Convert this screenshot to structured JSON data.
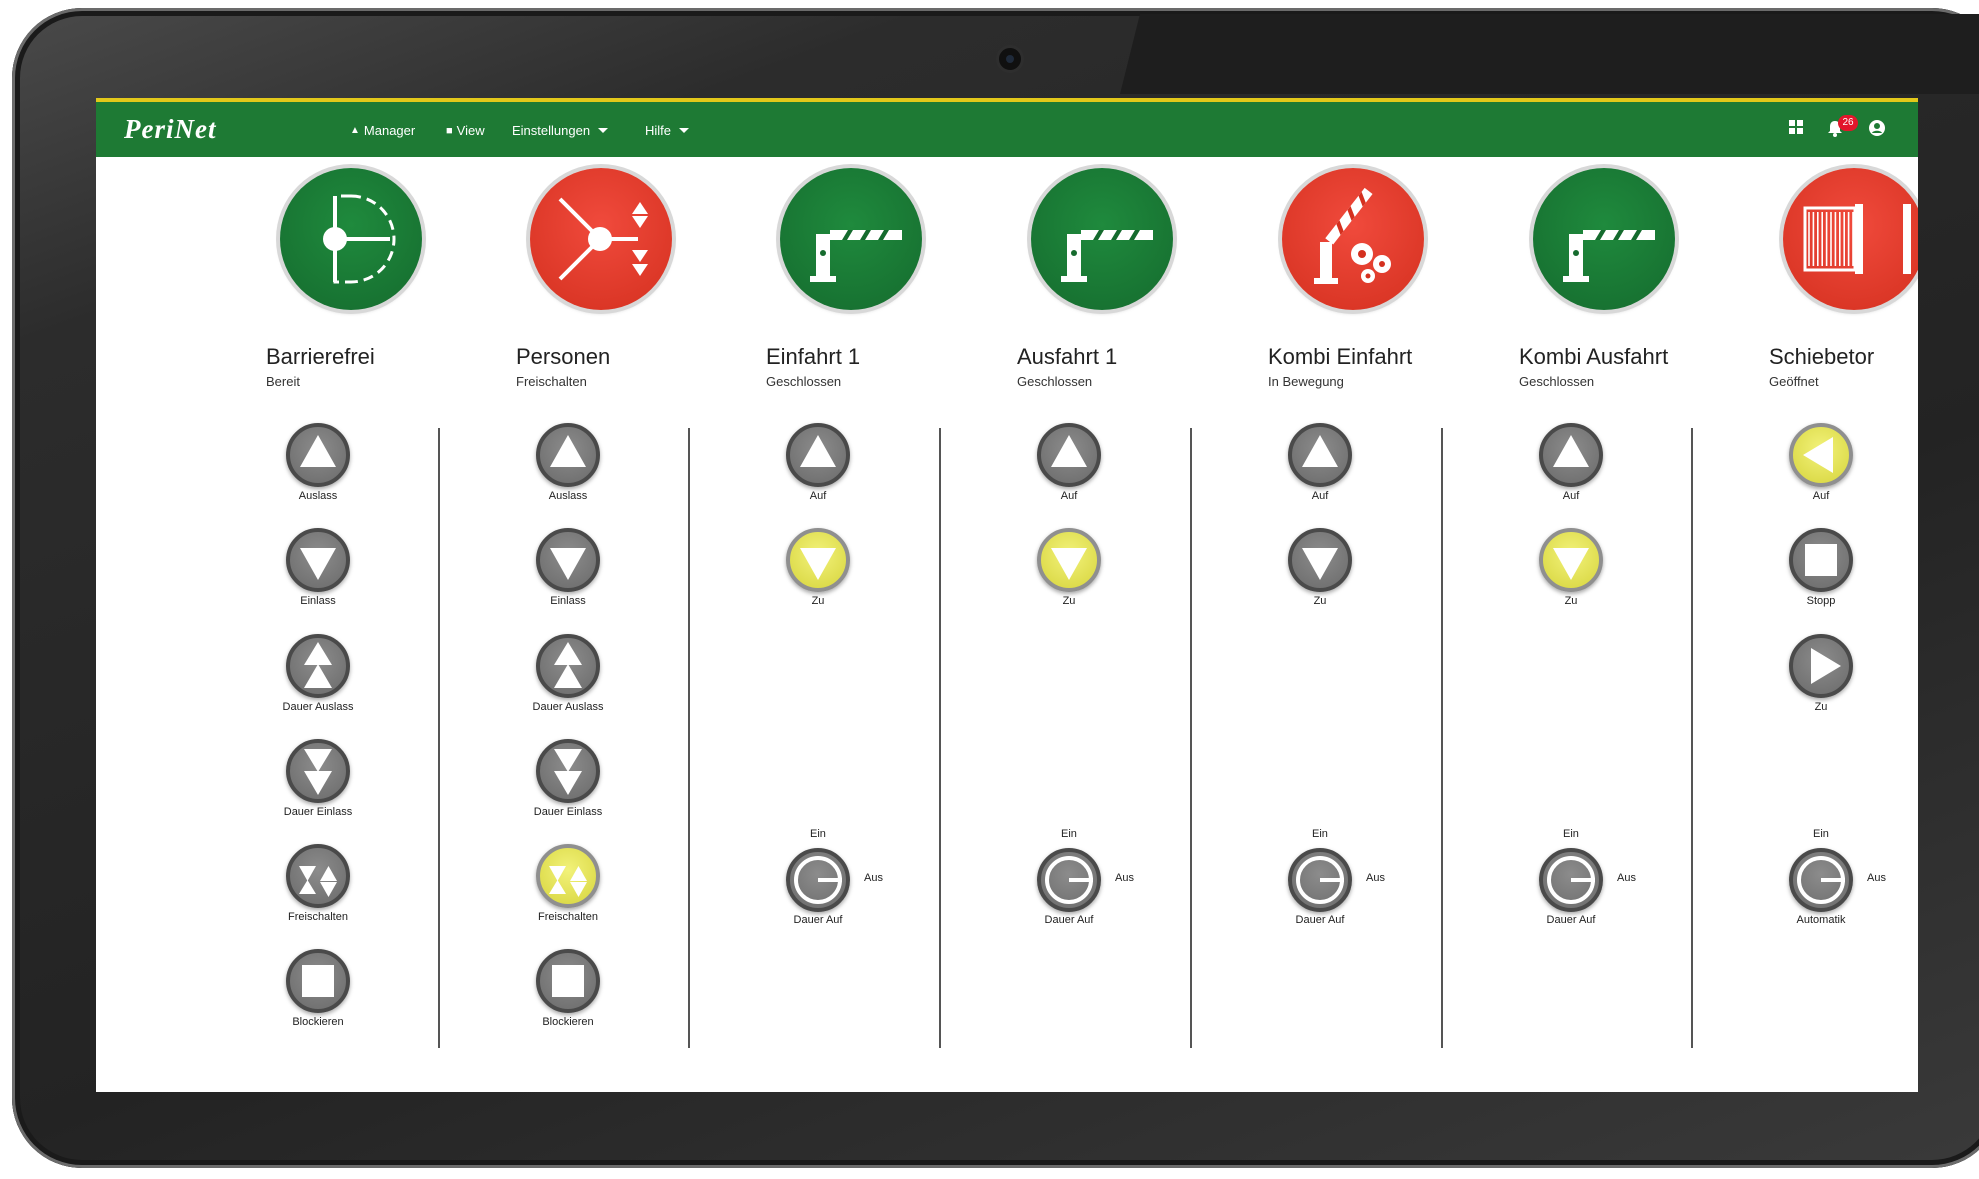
{
  "app": {
    "logo": "PeriNet"
  },
  "nav": {
    "manager": "Manager",
    "view": "View",
    "einstellungen": "Einstellungen",
    "hilfe": "Hilfe"
  },
  "notifications": {
    "count": "26"
  },
  "colors": {
    "topbar": "#1e7a34",
    "accent_line": "#e2c81a",
    "green_status": "#1f8a3d",
    "red_status": "#e53d2e",
    "active_button": "#e6e45a",
    "button_gray": "#7c7c7c"
  },
  "columns": [
    {
      "title": "Barrierefrei",
      "status": "Bereit",
      "icon": "door-swing-icon",
      "status_color": "green",
      "buttons": [
        {
          "label": "Auslass",
          "icon": "arrow-up-icon",
          "active": false
        },
        {
          "label": "Einlass",
          "icon": "arrow-down-icon",
          "active": false
        },
        {
          "label": "Dauer Auslass",
          "icon": "double-arrow-up-icon",
          "active": false
        },
        {
          "label": "Dauer Einlass",
          "icon": "double-arrow-down-icon",
          "active": false
        },
        {
          "label": "Freischalten",
          "icon": "freischalten-icon",
          "active": false
        },
        {
          "label": "Blockieren",
          "icon": "square-icon",
          "active": false
        }
      ]
    },
    {
      "title": "Personen",
      "status": "Freischalten",
      "icon": "turnstile-icon",
      "status_color": "red",
      "buttons": [
        {
          "label": "Auslass",
          "icon": "arrow-up-icon",
          "active": false
        },
        {
          "label": "Einlass",
          "icon": "arrow-down-icon",
          "active": false
        },
        {
          "label": "Dauer Auslass",
          "icon": "double-arrow-up-icon",
          "active": false
        },
        {
          "label": "Dauer Einlass",
          "icon": "double-arrow-down-icon",
          "active": false
        },
        {
          "label": "Freischalten",
          "icon": "freischalten-icon",
          "active": true
        },
        {
          "label": "Blockieren",
          "icon": "square-icon",
          "active": false
        }
      ]
    },
    {
      "title": "Einfahrt 1",
      "status": "Geschlossen",
      "icon": "barrier-closed-icon",
      "status_color": "green",
      "buttons": [
        {
          "label": "Auf",
          "icon": "arrow-up-icon",
          "active": false
        },
        {
          "label": "Zu",
          "icon": "arrow-down-icon",
          "active": true
        }
      ],
      "toggle": {
        "on": "Ein",
        "off": "Aus",
        "label": "Dauer Auf"
      }
    },
    {
      "title": "Ausfahrt 1",
      "status": "Geschlossen",
      "icon": "barrier-closed-icon",
      "status_color": "green",
      "buttons": [
        {
          "label": "Auf",
          "icon": "arrow-up-icon",
          "active": false
        },
        {
          "label": "Zu",
          "icon": "arrow-down-icon",
          "active": true
        }
      ],
      "toggle": {
        "on": "Ein",
        "off": "Aus",
        "label": "Dauer Auf"
      }
    },
    {
      "title": "Kombi Einfahrt",
      "status": "In Bewegung",
      "icon": "barrier-moving-icon",
      "status_color": "red",
      "buttons": [
        {
          "label": "Auf",
          "icon": "arrow-up-icon",
          "active": false
        },
        {
          "label": "Zu",
          "icon": "arrow-down-icon",
          "active": false
        }
      ],
      "toggle": {
        "on": "Ein",
        "off": "Aus",
        "label": "Dauer Auf"
      }
    },
    {
      "title": "Kombi Ausfahrt",
      "status": "Geschlossen",
      "icon": "barrier-closed-icon",
      "status_color": "green",
      "buttons": [
        {
          "label": "Auf",
          "icon": "arrow-up-icon",
          "active": false
        },
        {
          "label": "Zu",
          "icon": "arrow-down-icon",
          "active": true
        }
      ],
      "toggle": {
        "on": "Ein",
        "off": "Aus",
        "label": "Dauer Auf"
      }
    },
    {
      "title": "Schiebetor",
      "status": "Geöffnet",
      "icon": "sliding-gate-icon",
      "status_color": "red",
      "buttons": [
        {
          "label": "Auf",
          "icon": "arrow-left-icon",
          "active": true
        },
        {
          "label": "Stopp",
          "icon": "square-icon",
          "active": false
        },
        {
          "label": "Zu",
          "icon": "arrow-right-icon",
          "active": false
        }
      ],
      "toggle": {
        "on": "Ein",
        "off": "Aus",
        "label": "Automatik"
      }
    }
  ]
}
